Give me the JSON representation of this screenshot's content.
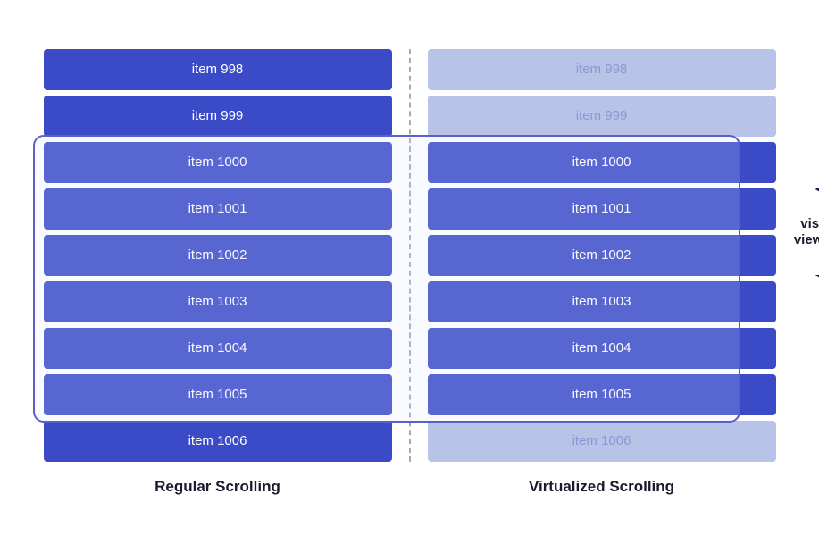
{
  "diagram": {
    "left_label": "Regular Scrolling",
    "right_label": "Virtualized Scrolling",
    "viewport_label_line1": "visible",
    "viewport_label_line2": "viewport",
    "items": [
      {
        "id": "item-998",
        "label": "item 998"
      },
      {
        "id": "item-999",
        "label": "item 999"
      },
      {
        "id": "item-1000",
        "label": "item 1000"
      },
      {
        "id": "item-1001",
        "label": "item 1001"
      },
      {
        "id": "item-1002",
        "label": "item 1002"
      },
      {
        "id": "item-1003",
        "label": "item 1003"
      },
      {
        "id": "item-1004",
        "label": "item 1004"
      },
      {
        "id": "item-1005",
        "label": "item 1005"
      },
      {
        "id": "item-1006",
        "label": "item 1006"
      }
    ]
  }
}
